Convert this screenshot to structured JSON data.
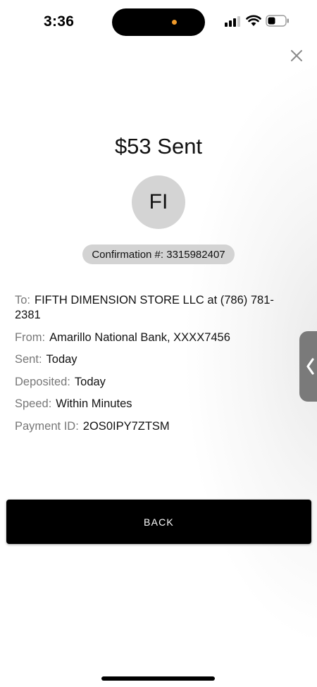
{
  "status_bar": {
    "time": "3:36"
  },
  "title": "$53 Sent",
  "avatar_initials": "FI",
  "confirmation": "Confirmation #: 3315982407",
  "details": [
    {
      "label": "To:",
      "value": "FIFTH DIMENSION STORE LLC at (786) 781-2381"
    },
    {
      "label": "From:",
      "value": "Amarillo National Bank, XXXX7456"
    },
    {
      "label": "Sent:",
      "value": "Today"
    },
    {
      "label": "Deposited:",
      "value": "Today"
    },
    {
      "label": "Speed:",
      "value": "Within Minutes"
    },
    {
      "label": "Payment ID:",
      "value": "2OS0IPY7ZTSM"
    }
  ],
  "back_label": "BACK",
  "icons": {
    "close": "close-icon",
    "side_tab": "chevron-left-icon",
    "wifi": "wifi-icon",
    "battery": "battery-icon",
    "signal": "signal-icon"
  },
  "colors": {
    "button_bg": "#000000",
    "avatar_bg": "#d4d4d4",
    "pill_bg": "#d3d3d3",
    "label": "#777777",
    "side_tab": "#7a7a7a",
    "island_dot": "#f09a2a"
  }
}
